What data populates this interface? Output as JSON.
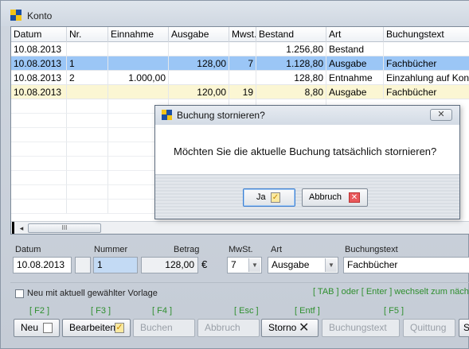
{
  "window": {
    "title": "Konto"
  },
  "grid": {
    "columns": [
      "Datum",
      "Nr.",
      "Einnahme",
      "Ausgabe",
      "Mwst.",
      "Bestand",
      "Art",
      "Buchungstext"
    ],
    "rows": [
      {
        "datum": "10.08.2013",
        "nr": "",
        "einnahme": "",
        "ausgabe": "",
        "mwst": "",
        "bestand": "1.256,80",
        "art": "Bestand",
        "text": ""
      },
      {
        "datum": "10.08.2013",
        "nr": "1",
        "einnahme": "",
        "ausgabe": "128,00",
        "mwst": "7",
        "bestand": "1.128,80",
        "art": "Ausgabe",
        "text": "Fachbücher"
      },
      {
        "datum": "10.08.2013",
        "nr": "2",
        "einnahme": "1.000,00",
        "ausgabe": "",
        "mwst": "",
        "bestand": "128,80",
        "art": "Entnahme",
        "text": "Einzahlung auf Kon"
      },
      {
        "datum": "10.08.2013",
        "nr": "",
        "einnahme": "",
        "ausgabe": "120,00",
        "mwst": "19",
        "bestand": "8,80",
        "art": "Ausgabe",
        "text": "Fachbücher"
      }
    ],
    "scroll_left": "◂",
    "scroll_thumb": "III"
  },
  "dialog": {
    "title": "Buchung stornieren?",
    "close": "✕",
    "message": "Möchten Sie die aktuelle Buchung tatsächlich stornieren?",
    "yes_label": "Ja",
    "cancel_label": "Abbruch"
  },
  "editor": {
    "labels": {
      "datum": "Datum",
      "nummer": "Nummer",
      "betrag": "Betrag",
      "mwst": "MwSt.",
      "art": "Art",
      "buchungstext": "Buchungstext"
    },
    "values": {
      "datum": "10.08.2013",
      "nummer": "1",
      "betrag": "128,00",
      "currency": "€",
      "mwst": "7",
      "art": "Ausgabe",
      "buchungstext": "Fachbücher"
    },
    "checkbox_label": "Neu mit aktuell gewählter Vorlage",
    "hint": "[ TAB ] oder [ Enter ] wechselt zum nächs"
  },
  "toolbar": {
    "keys": {
      "neu": "[ F2 ]",
      "bearbeiten": "[ F3 ]",
      "buchen": "[ F4 ]",
      "abbruch": "[ Esc ]",
      "storno": "[ Entf ]",
      "buchungstext": "[ F5 ]"
    },
    "buttons": {
      "neu": "Neu",
      "bearbeiten": "Bearbeiten",
      "buchen": "Buchen",
      "abbruch": "Abbruch",
      "storno": "Storno",
      "buchungstext": "Buchungstext",
      "quittung": "Quittung",
      "last": "S"
    }
  },
  "colors": {
    "selected_row": "#9bc6f6",
    "yellow_row": "#fbf6d3",
    "hint_green": "#2f8f2f",
    "dialog_cancel_red": "#e9585b"
  }
}
